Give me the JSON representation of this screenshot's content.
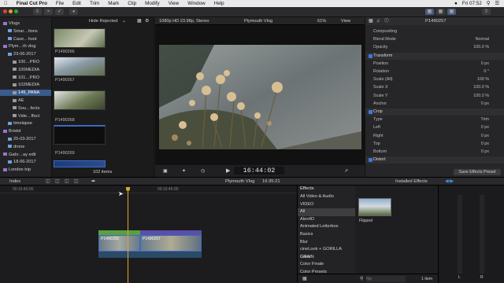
{
  "menubar": {
    "app": "Final Cut Pro",
    "items": [
      "File",
      "Edit",
      "Trim",
      "Mark",
      "Clip",
      "Modify",
      "View",
      "Window",
      "Help"
    ],
    "clock": "Fri 07:52"
  },
  "library": {
    "items": [
      {
        "label": "Vlogs",
        "level": 0
      },
      {
        "label": "Smar…tions",
        "level": 1
      },
      {
        "label": "Case…hoot",
        "level": 1
      },
      {
        "label": "Plym…th vlog",
        "level": 0
      },
      {
        "label": "23-06-2017",
        "level": 1
      },
      {
        "label": "100…PRO",
        "level": 2
      },
      {
        "label": "100MEDIA",
        "level": 2
      },
      {
        "label": "101…PRO",
        "level": 2
      },
      {
        "label": "102MEDIA",
        "level": 2
      },
      {
        "label": "149_PANA",
        "level": 2,
        "selected": true
      },
      {
        "label": "AE",
        "level": 2
      },
      {
        "label": "Sou…fects",
        "level": 2
      },
      {
        "label": "Vide…ffect",
        "level": 2
      },
      {
        "label": "timelapse",
        "level": 1
      },
      {
        "label": "Bristol",
        "level": 0
      },
      {
        "label": "25-03-2017",
        "level": 1
      },
      {
        "label": "drone",
        "level": 1
      },
      {
        "label": "Gabr…ay edit",
        "level": 0
      },
      {
        "label": "18-06-2017",
        "level": 1
      },
      {
        "label": "London trip",
        "level": 0
      }
    ]
  },
  "browser": {
    "filter": "Hide Rejected",
    "clips": [
      "P1490266",
      "P1490267",
      "P1490268",
      "P1490269"
    ],
    "count": "102 items"
  },
  "viewer": {
    "format": "1080p HD 23.98p, Stereo",
    "title": "Plymouth Vlog",
    "zoom": "61%",
    "view": "View",
    "timecode": "16:44:02"
  },
  "inspector": {
    "clip": "P1490257",
    "rows": [
      {
        "label": "Compositing",
        "value": "",
        "type": "sub"
      },
      {
        "label": "Blend Mode",
        "value": "Normal"
      },
      {
        "label": "Opacity",
        "value": "100.0 %"
      },
      {
        "label": "Transform",
        "value": "",
        "type": "hdr"
      },
      {
        "label": "Position",
        "value": "0 px"
      },
      {
        "label": "Rotation",
        "value": "0 °"
      },
      {
        "label": "Scale (All)",
        "value": "100 %"
      },
      {
        "label": "Scale X",
        "value": "100.0 %"
      },
      {
        "label": "Scale Y",
        "value": "100.0 %"
      },
      {
        "label": "Anchor",
        "value": "0 px"
      },
      {
        "label": "Crop",
        "value": "",
        "type": "hdr"
      },
      {
        "label": "Type",
        "value": "Trim"
      },
      {
        "label": "Left",
        "value": "0 px"
      },
      {
        "label": "Right",
        "value": "0 px"
      },
      {
        "label": "Top",
        "value": "0 px"
      },
      {
        "label": "Bottom",
        "value": "0 px"
      },
      {
        "label": "Distort",
        "value": "",
        "type": "hdr"
      }
    ],
    "save_button": "Save Effects Preset"
  },
  "timeline": {
    "index": "Index",
    "project": "Plymouth Vlog",
    "duration": "16:35:21",
    "clip_labels": [
      "P1490255",
      "P1490257"
    ],
    "ruler": [
      "00:16:40:00",
      "00:16:45:00"
    ]
  },
  "effects": {
    "header": "Effects",
    "installed": "Installed Effects",
    "items": [
      "All Video & Audio",
      "VIDEO",
      "All",
      "Alex4D",
      "Animated Letterbox",
      "Basics",
      "Blur",
      "cineLook + GORILLA GRAIN",
      "Color",
      "Color Finale",
      "Color Presets"
    ],
    "selected": "All",
    "thumb_label": "Flipped",
    "search_placeholder": "flip",
    "count": "1 item"
  },
  "colors": {
    "accent": "#3d7ad8",
    "clip_green": "#5aa03c",
    "clip_purple": "#5b4fa6",
    "playhead": "#e0a52b"
  }
}
